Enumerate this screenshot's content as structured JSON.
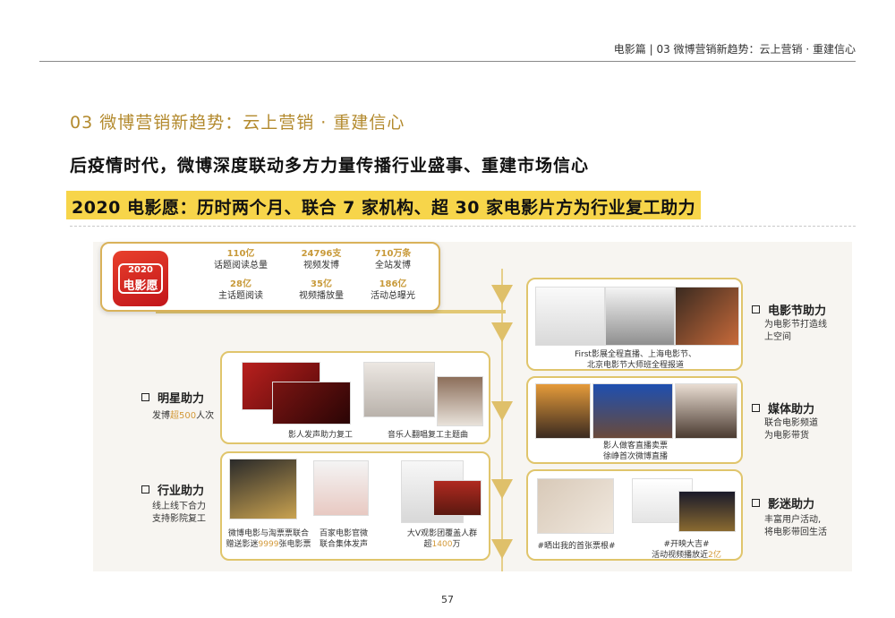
{
  "header": {
    "text": "电影篇 | 03 微博营销新趋势：云上营销 · 重建信心"
  },
  "section_title": "03 微博营销新趋势：云上营销 · 重建信心",
  "headline": "后疫情时代，微博深度联动多方力量传播行业盛事、重建市场信心",
  "highlight": "2020 电影愿：历时两个月、联合 7 家机构、超 30 家电影片方为行业复工助力",
  "logo": {
    "year": "2020",
    "name": "电影愿"
  },
  "stats": [
    {
      "value": "110亿",
      "label": "话题阅读总量"
    },
    {
      "value": "24796支",
      "label": "视频发博"
    },
    {
      "value": "710万条",
      "label": "全站发博"
    },
    {
      "value": "28亿",
      "label": "主话题阅读"
    },
    {
      "value": "35亿",
      "label": "视频播放量"
    },
    {
      "value": "186亿",
      "label": "活动总曝光"
    }
  ],
  "left": [
    {
      "title": "明星助力",
      "desc_pre": "发博",
      "desc_hl": "超500",
      "desc_post": "人次"
    },
    {
      "title": "行业助力",
      "desc_line1": "线上线下合力",
      "desc_line2": "支持影院复工"
    }
  ],
  "right": [
    {
      "title": "电影节助力",
      "desc_line1": "为电影节打造线",
      "desc_line2": "上空间"
    },
    {
      "title": "媒体助力",
      "desc_line1": "联合电影频道",
      "desc_line2": "为电影带货"
    },
    {
      "title": "影迷助力",
      "desc_line1": "丰富用户活动,",
      "desc_line2": "将电影带回生活"
    }
  ],
  "captions": {
    "star_a": "影人发声助力复工",
    "star_b": "音乐人翻唱复工主题曲",
    "ind_a_l1": "微博电影与淘票票联合",
    "ind_a_l2_pre": "赠送影迷",
    "ind_a_l2_hl": "9999",
    "ind_a_l2_post": "张电影票",
    "ind_b_l1": "百家电影官微",
    "ind_b_l2": "联合集体发声",
    "ind_c_l1": "大V观影团覆盖人群",
    "ind_c_l2_pre": "超",
    "ind_c_l2_hl": "1400",
    "ind_c_l2_post": "万",
    "fest_l1": "First影展全程直播、上海电影节、",
    "fest_l2": "北京电影节大师班全程报道",
    "media_l1": "影人做客直播卖票",
    "media_l2": "徐峥首次微博直播",
    "fan_a": "#晒出我的首张票根#",
    "fan_b_l1": "#开映大吉#",
    "fan_b_l2_pre": "活动视频播放近",
    "fan_b_l2_hl": "2亿"
  },
  "page_number": "57"
}
